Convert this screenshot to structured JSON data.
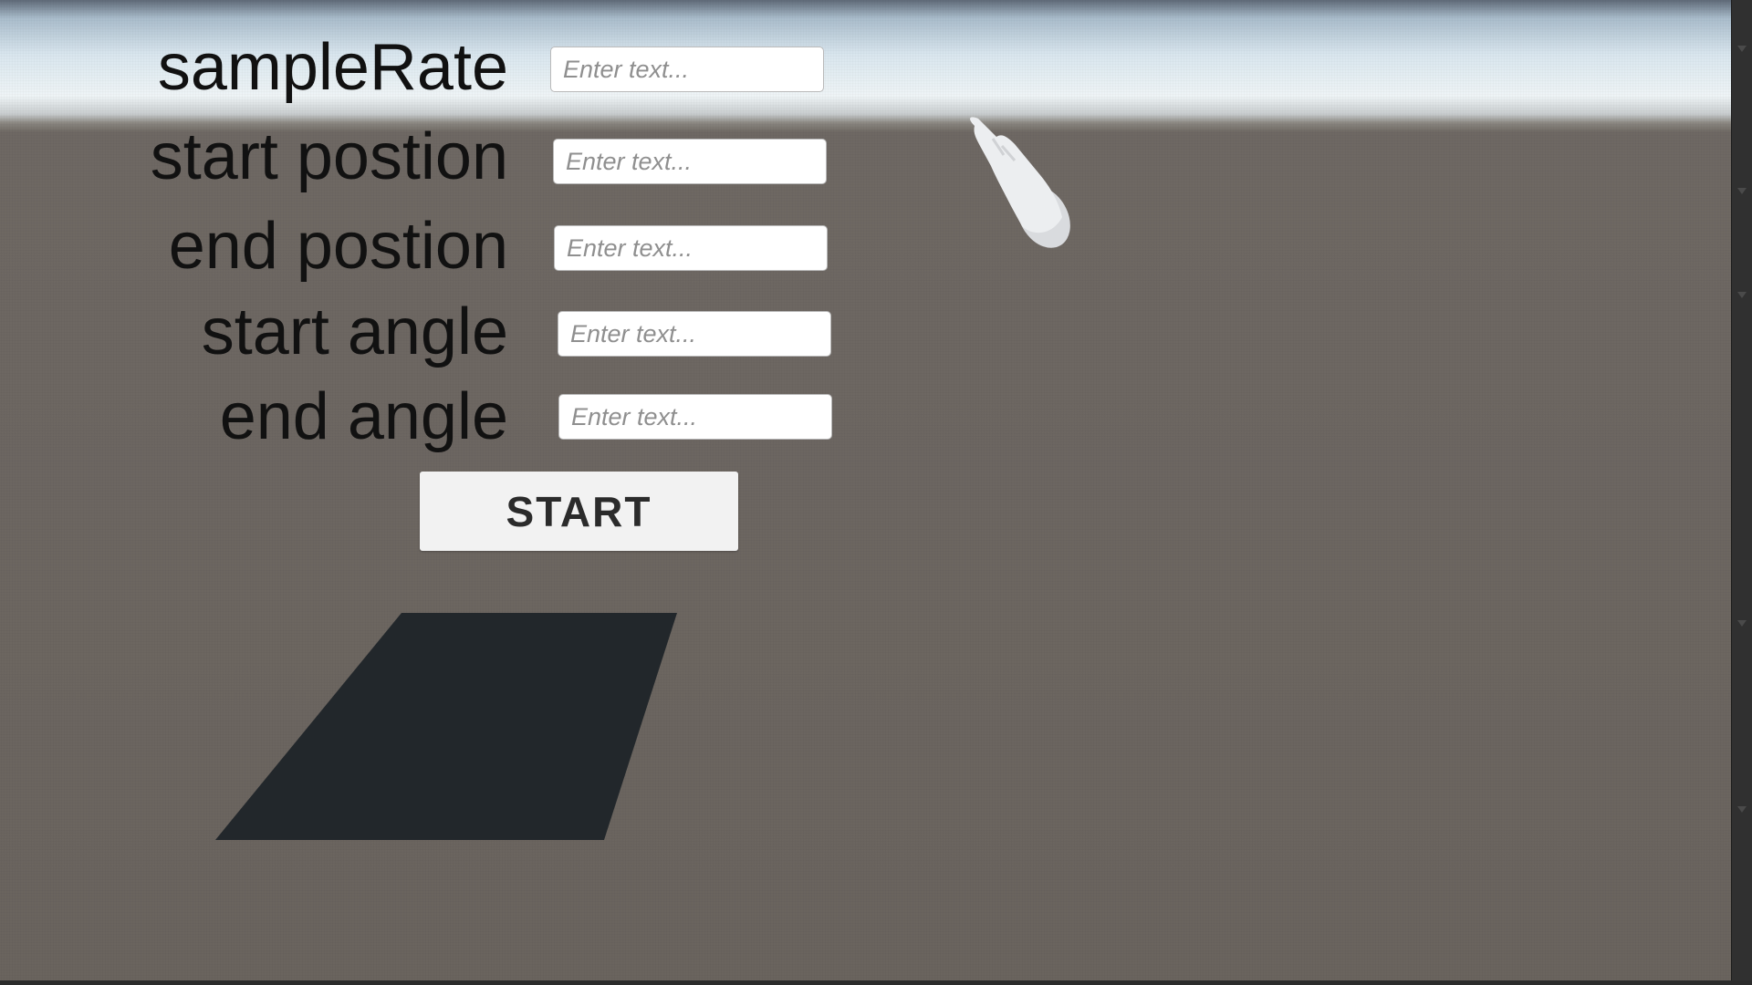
{
  "form": {
    "fields": [
      {
        "label": "sampleRate",
        "placeholder": "Enter text..."
      },
      {
        "label": "start postion",
        "placeholder": "Enter text..."
      },
      {
        "label": "end postion",
        "placeholder": "Enter text..."
      },
      {
        "label": "start angle",
        "placeholder": "Enter text..."
      },
      {
        "label": "end angle",
        "placeholder": "Enter text..."
      }
    ],
    "start_label": "START"
  },
  "scene": {
    "sky_color": "#eef4f6",
    "ground_color": "#6a645e",
    "plane_color": "#22272b",
    "hand_color": "#e9eaec"
  }
}
